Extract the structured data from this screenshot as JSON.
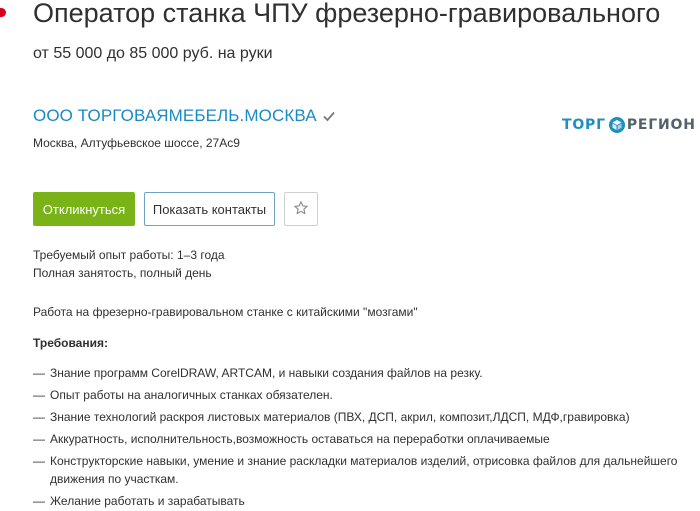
{
  "vacancy": {
    "title": "Оператор станка ЧПУ фрезерно-гравировального",
    "salary": "от 55 000 до 85 000 руб. на руки"
  },
  "company": {
    "name": "ООО ТОРГОВАЯМЕБЕЛЬ.МОСКВА",
    "verified_icon": "checkmark-icon",
    "address": "Москва, Алтуфьевское шоссе, 27Ас9",
    "logo": {
      "part1": "ТОРГ",
      "part2": "РЕГИОН",
      "mark_icon": "cube-logo-icon"
    }
  },
  "actions": {
    "respond_label": "Откликнуться",
    "contacts_label": "Показать контакты",
    "favorite_icon": "star-outline-icon"
  },
  "details": {
    "experience": "Требуемый опыт работы: 1–3 года",
    "employment": "Полная занятость, полный день"
  },
  "description": "Работа на фрезерно-гравировальном станке с китайскими \"мозгами\"",
  "requirements": {
    "heading": "Требования:",
    "dash": "—",
    "items": [
      "Знание программ CorelDRAW, ARTCAM, и навыки создания файлов на резку.",
      "Опыт работы на аналогичных станках обязателен.",
      "Знание технологий раскроя листовых материалов (ПВХ, ДСП, акрил, композит,ЛДСП, МДФ,гравировка)",
      "Аккуратность, исполнительность,возможность оставаться на переработки оплачиваемые",
      "Конструкторские навыки, умение и знание раскладки материалов изделий, отрисовка файлов для дальнейшего движения по участкам.",
      "Желание работать и зарабатывать"
    ]
  },
  "colors": {
    "accent_link": "#1a8ac4",
    "respond_button": "#7ab317",
    "text": "#303030"
  }
}
